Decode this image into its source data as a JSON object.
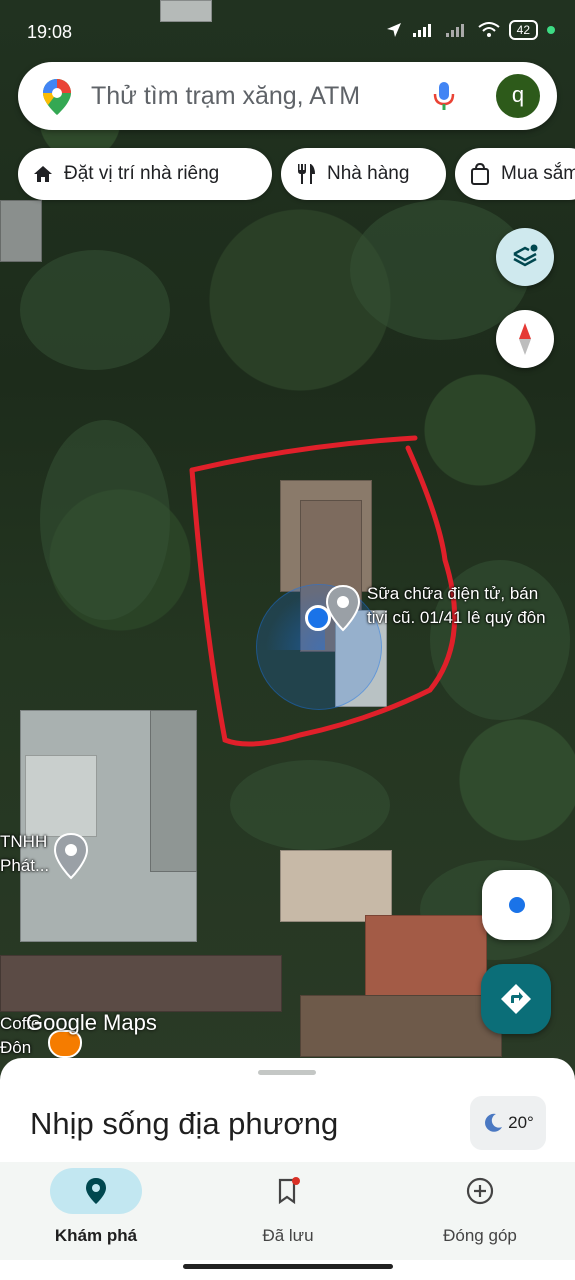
{
  "status_bar": {
    "time": "19:08",
    "battery": "42"
  },
  "search": {
    "placeholder": "Thử tìm trạm xăng, ATM",
    "avatar_letter": "q"
  },
  "chips": [
    {
      "label": "Đặt vị trí nhà riêng",
      "icon": "home-icon"
    },
    {
      "label": "Nhà hàng",
      "icon": "restaurant-icon"
    },
    {
      "label": "Mua sắm",
      "icon": "shopping-bag-icon"
    }
  ],
  "map": {
    "places": [
      {
        "name_line1": "Sữa chữa điện tử, bán",
        "name_line2": "tivi cũ. 01/41 lê quý đôn"
      },
      {
        "name_line1": "TNHH",
        "name_line2": "Phát..."
      },
      {
        "name_line1": "Coffe",
        "name_line2": "Đôn"
      }
    ],
    "watermark": "Google Maps"
  },
  "sheet": {
    "title": "Nhịp sống địa phương",
    "weather_temp": "20°"
  },
  "nav": [
    {
      "label": "Khám phá",
      "icon": "explore-pin-icon",
      "active": true
    },
    {
      "label": "Đã lưu",
      "icon": "bookmark-icon",
      "active": false
    },
    {
      "label": "Đóng góp",
      "icon": "add-circle-icon",
      "active": false
    }
  ],
  "colors": {
    "accent": "#00695c",
    "active_pill": "#c2e7f1",
    "outline": "#e0202a",
    "location_dot": "#1a73e8"
  }
}
